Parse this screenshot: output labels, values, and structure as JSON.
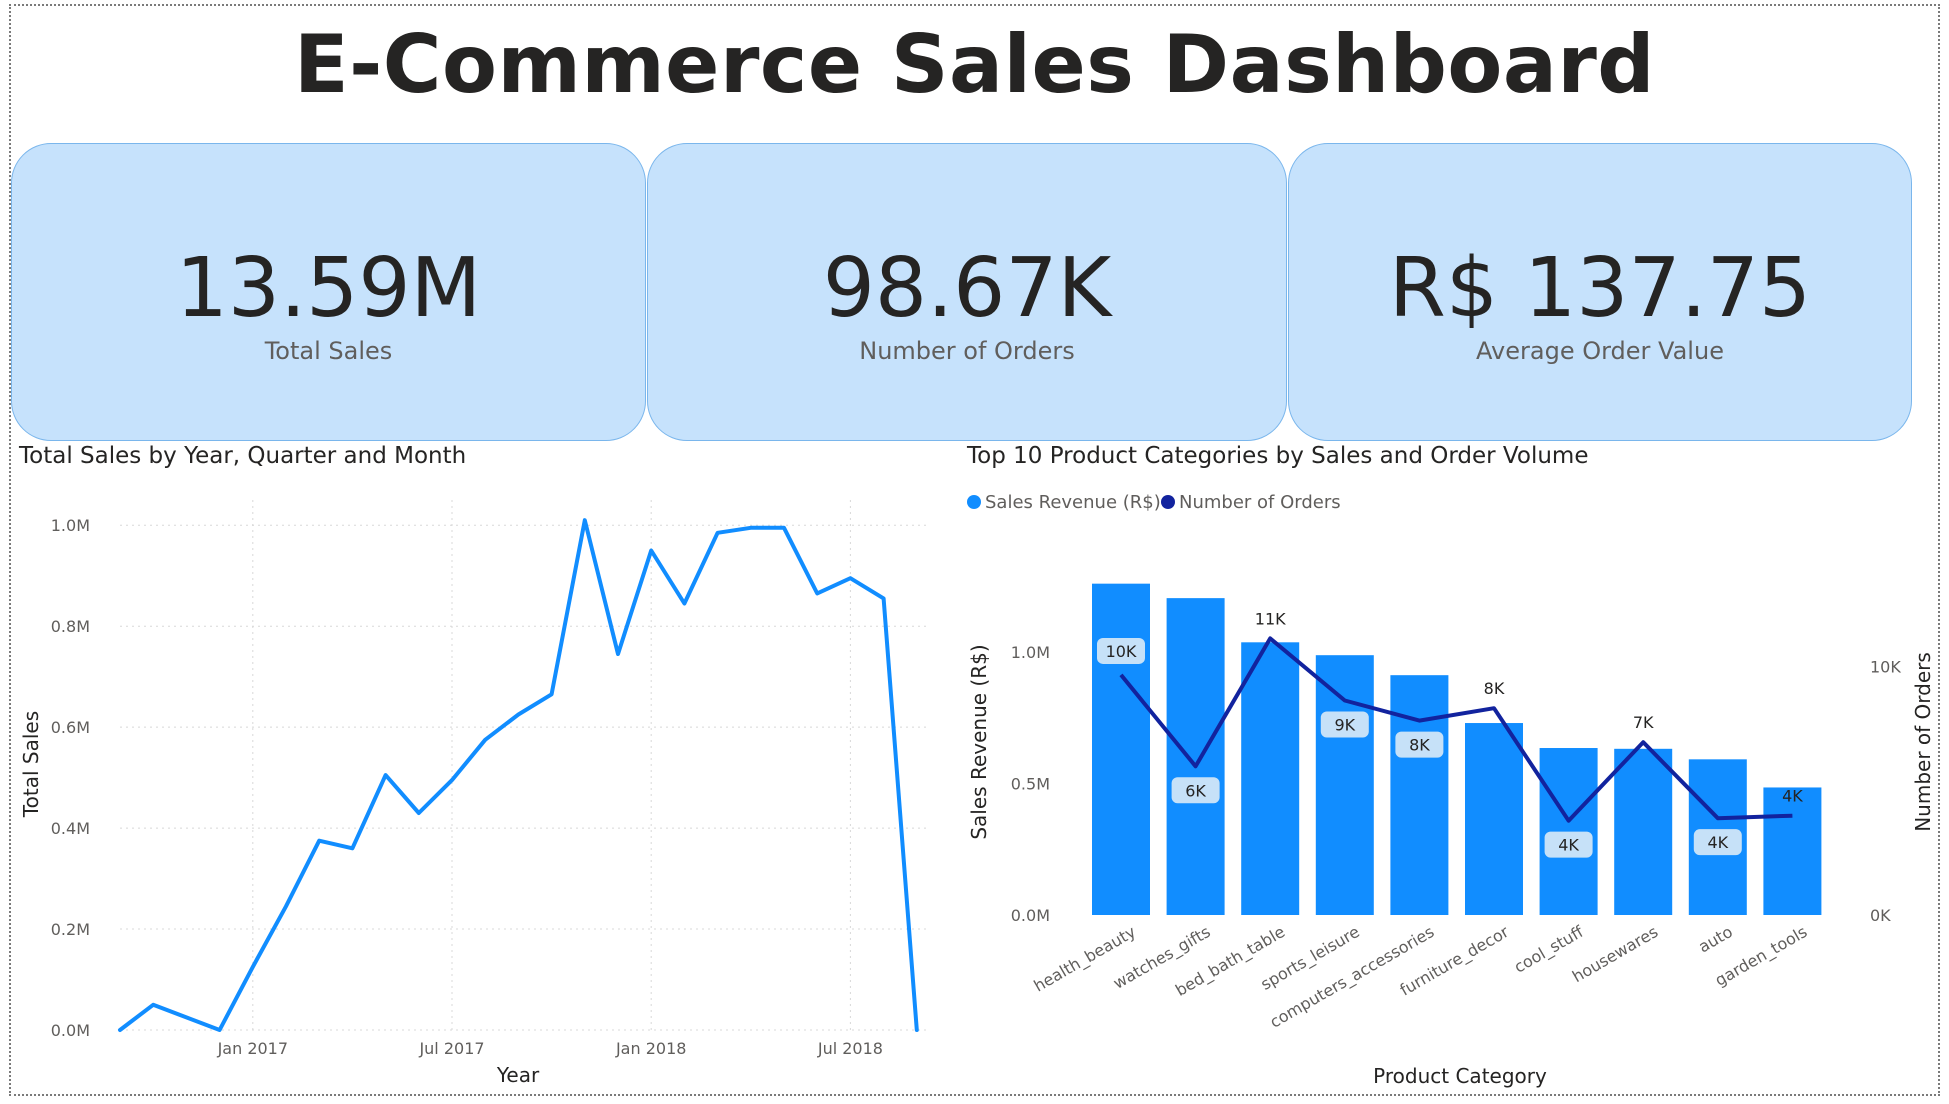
{
  "title": "E-Commerce Sales Dashboard",
  "kpis": [
    {
      "value": "13.59M",
      "label": "Total Sales"
    },
    {
      "value": "98.67K",
      "label": "Number of Orders"
    },
    {
      "value": "R$ 137.75",
      "label": "Average Order Value"
    }
  ],
  "colors": {
    "kpi_bg": "#c6e2fc",
    "line": "#118dff",
    "bar": "#118dff",
    "orders_line": "#12239e"
  },
  "chart_data": [
    {
      "type": "line",
      "title": "Total Sales by Year, Quarter and Month",
      "xlabel": "Year",
      "ylabel": "Total Sales",
      "x_tick_labels": [
        "Jan 2017",
        "Jul 2017",
        "Jan 2018",
        "Jul 2018"
      ],
      "x_tick_dates": [
        "2017-01",
        "2017-07",
        "2018-01",
        "2018-07"
      ],
      "y_tick_labels": [
        "0.0M",
        "0.2M",
        "0.4M",
        "0.6M",
        "0.8M",
        "1.0M"
      ],
      "y_tick_values": [
        0,
        200000,
        400000,
        600000,
        800000,
        1000000
      ],
      "ylim": [
        0,
        1050000
      ],
      "grid": true,
      "x": [
        "2016-09",
        "2016-10",
        "2016-11",
        "2016-12",
        "2017-01",
        "2017-02",
        "2017-03",
        "2017-04",
        "2017-05",
        "2017-06",
        "2017-07",
        "2017-08",
        "2017-09",
        "2017-10",
        "2017-11",
        "2017-12",
        "2018-01",
        "2018-02",
        "2018-03",
        "2018-04",
        "2018-05",
        "2018-06",
        "2018-07",
        "2018-08",
        "2018-09"
      ],
      "y": [
        0,
        50000,
        25000,
        0,
        125000,
        245000,
        375000,
        360000,
        505000,
        430000,
        495000,
        575000,
        625000,
        665000,
        1010000,
        745000,
        950000,
        845000,
        985000,
        995000,
        995000,
        865000,
        895000,
        855000,
        0
      ]
    },
    {
      "type": "bar",
      "title": "Top 10 Product Categories by Sales and Order Volume",
      "xlabel": "Product Category",
      "ylabel": "Sales Revenue (R$)",
      "y2label": "Number of Orders",
      "categories": [
        "health_beauty",
        "watches_gifts",
        "bed_bath_table",
        "sports_leisure",
        "computers_accessories",
        "furniture_decor",
        "cool_stuff",
        "housewares",
        "auto",
        "garden_tools"
      ],
      "series": [
        {
          "name": "Sales Revenue (R$)",
          "kind": "bar",
          "axis": "left",
          "values": [
            1260000,
            1205000,
            1037000,
            988000,
            912000,
            730000,
            635000,
            632000,
            592000,
            485000
          ]
        },
        {
          "name": "Number of Orders",
          "kind": "line",
          "axis": "right",
          "values": [
            9670,
            5990,
            11140,
            8640,
            7830,
            8330,
            3800,
            6960,
            3900,
            4000
          ],
          "labels": [
            "10K",
            "6K",
            "11K",
            "9K",
            "8K",
            "8K",
            "4K",
            "7K",
            "4K",
            "4K"
          ]
        }
      ],
      "y_tick_labels": [
        "0.0M",
        "0.5M",
        "1.0M"
      ],
      "y_tick_values": [
        0,
        500000,
        1000000
      ],
      "ylim": [
        0,
        1350000
      ],
      "y2_tick_labels": [
        "0K",
        "10K"
      ],
      "y2_tick_values": [
        0,
        10000
      ],
      "y2lim": [
        0,
        14300
      ],
      "legend_position": "top-left",
      "grid": false
    }
  ]
}
